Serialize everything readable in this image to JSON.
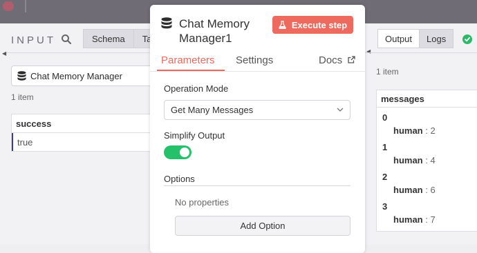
{
  "input_panel": {
    "title": "INPUT",
    "tabs": [
      "Schema",
      "Ta"
    ],
    "node_name": "Chat Memory Manager",
    "item_count": "1 item",
    "table": {
      "header": "success",
      "value": "true"
    }
  },
  "node_panel": {
    "title": "Chat Memory Manager1",
    "execute_label": "Execute step",
    "tabs": {
      "parameters": "Parameters",
      "settings": "Settings",
      "docs": "Docs"
    },
    "operation_mode": {
      "label": "Operation Mode",
      "value": "Get Many Messages"
    },
    "simplify_output": {
      "label": "Simplify Output",
      "enabled": true
    },
    "options": {
      "label": "Options",
      "empty_text": "No properties",
      "add_label": "Add Option"
    }
  },
  "output_panel": {
    "tabs": [
      "Output",
      "Logs"
    ],
    "item_count": "1 item",
    "table_header": "messages",
    "messages": [
      {
        "index": "0",
        "key": "human",
        "value": ": 2"
      },
      {
        "index": "1",
        "key": "human",
        "value": ": 4"
      },
      {
        "index": "2",
        "key": "human",
        "value": ": 6"
      },
      {
        "index": "3",
        "key": "human",
        "value": ": 7"
      }
    ]
  },
  "colors": {
    "accent": "#e8695d",
    "execute": "#ee6a5e",
    "toggle": "#25c06a",
    "success": "#2fb86a"
  }
}
